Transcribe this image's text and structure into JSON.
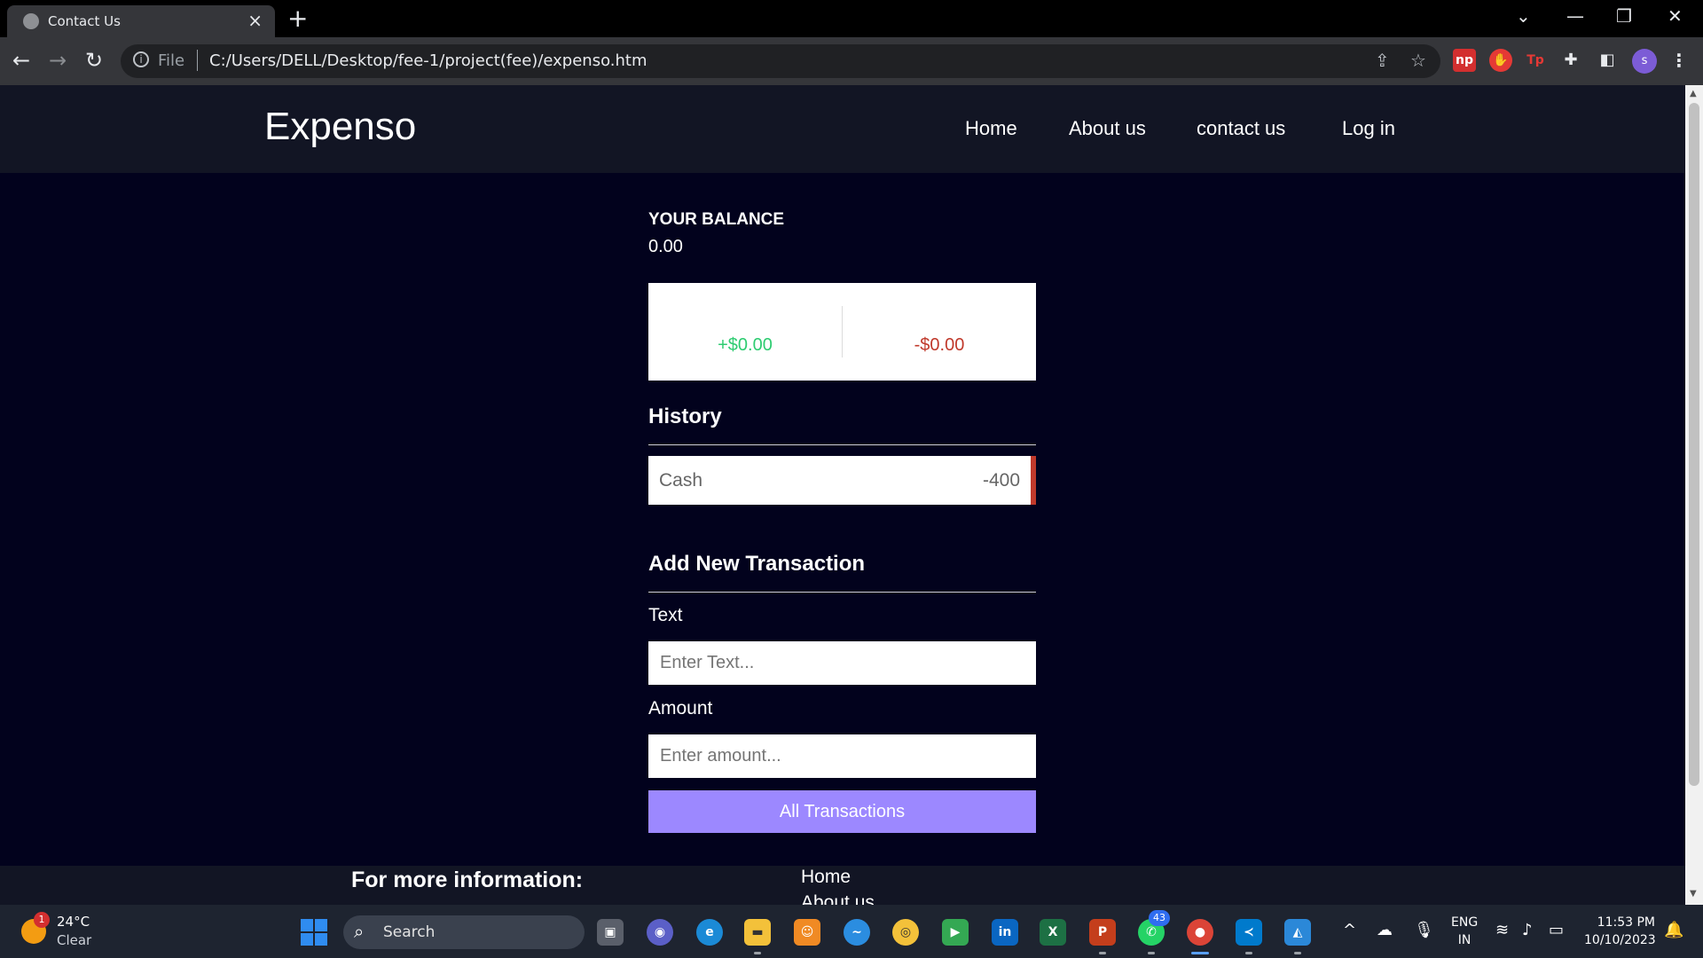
{
  "browser": {
    "tab_title": "Contact Us",
    "address_scheme": "File",
    "address_url": "C:/Users/DELL/Desktop/fee-1/project(fee)/expenso.htm",
    "profile_initial": "s"
  },
  "site": {
    "logo": "Expenso",
    "nav": [
      "Home",
      "About us",
      "contact us",
      "Log in"
    ]
  },
  "balance": {
    "title": "YOUR BALANCE",
    "value": "0.00",
    "income": "+$0.00",
    "expense": "-$0.00"
  },
  "history": {
    "title": "History",
    "items": [
      {
        "text": "Cash",
        "amount": "-400"
      }
    ]
  },
  "add_transaction": {
    "title": "Add New Transaction",
    "text_label": "Text",
    "text_placeholder": "Enter Text...",
    "amount_label": "Amount",
    "amount_placeholder": "Enter amount...",
    "button": "All Transactions"
  },
  "footer": {
    "info": "For more information:",
    "links": [
      "Home",
      "About us"
    ]
  },
  "taskbar": {
    "weather_alerts": "1",
    "temperature": "24°C",
    "condition": "Clear",
    "search_label": "Search",
    "whatsapp_badge": "43",
    "language": "ENG",
    "region": "IN",
    "time": "11:53 PM",
    "date": "10/10/2023"
  },
  "colors": {
    "page_bg": "#02021d",
    "header_bg": "#121524",
    "income": "#2ecc71",
    "expense": "#c0392b",
    "button": "#9c88ff"
  }
}
